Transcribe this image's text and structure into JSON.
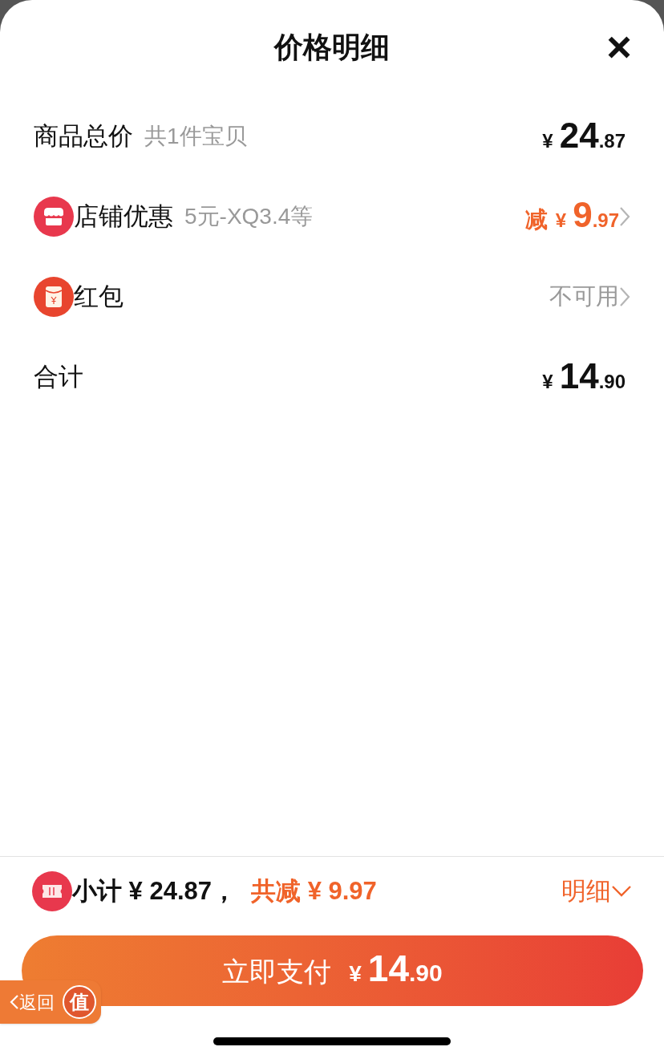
{
  "sheet": {
    "title": "价格明细",
    "close": "×"
  },
  "rows": [
    {
      "label": "商品总价",
      "note": "共1件宝贝",
      "amount": {
        "currency": "¥",
        "integer": "24",
        "decimal": ".87"
      },
      "highlight": false,
      "chevron": false
    },
    {
      "kind": "shop",
      "label": "店铺优惠",
      "note": "5元-XQ3.4等",
      "amount": {
        "prefix": "减",
        "currency": "¥",
        "integer": "9",
        "decimal": ".97"
      },
      "highlight": true,
      "chevron": true
    },
    {
      "kind": "envelope",
      "label": "红包",
      "status": "不可用",
      "highlight": false,
      "chevron": true
    },
    {
      "label": "合计",
      "amount": {
        "currency": "¥",
        "integer": "14",
        "decimal": ".90"
      },
      "highlight": false,
      "chevron": false
    }
  ],
  "summary": {
    "subtotal": "小计 ¥ 24.87，",
    "discount": "共减 ¥ 9.97",
    "details": "明细",
    "expanded": false
  },
  "pay_button": {
    "label": "立即支付",
    "currency": "¥",
    "integer": "14",
    "decimal": ".90"
  },
  "back_button": {
    "label": "返回",
    "badge": "值"
  }
}
